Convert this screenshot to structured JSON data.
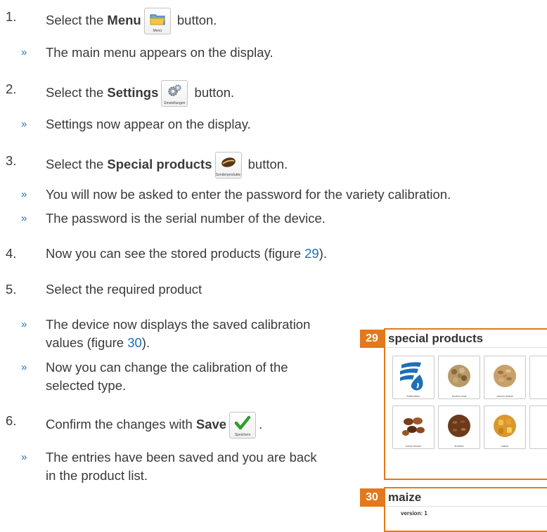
{
  "steps": [
    {
      "number": "1.",
      "prefix": "Select the ",
      "bold": "Menu",
      "suffix": " button.",
      "icon_name": "folder-icon",
      "icon_caption": "Menü"
    },
    {
      "number": "2.",
      "prefix": "Select the ",
      "bold": "Settings",
      "suffix": " button.",
      "icon_name": "gears-icon",
      "icon_caption": "Einstellungen"
    },
    {
      "number": "3.",
      "prefix": "Select the ",
      "bold": "Special products",
      "suffix": " button.",
      "icon_name": "bean-icon",
      "icon_caption": "Sonderprodukte"
    },
    {
      "number": "4.",
      "prefix": "Now you can see the stored products (figure ",
      "link": "29",
      "suffix": ")."
    },
    {
      "number": "5.",
      "text": "Select the required product"
    },
    {
      "number": "6.",
      "prefix": "Confirm the changes with ",
      "bold": "Save",
      "suffix": ".",
      "icon_name": "checkmark-icon",
      "icon_caption": "Speichern"
    }
  ],
  "results": {
    "r1": "The main menu appears on the display.",
    "r2": "Settings now appear on the display.",
    "r3a": "You will now be asked to enter the password for the variety calibration.",
    "r3b": "The password is the serial number of the device.",
    "r5a_l1": "The device now displays the saved calibration",
    "r5a_l2_pre": "values (figure ",
    "r5a_link": "30",
    "r5a_l2_suf": ").",
    "r5b_l1": "Now you can change the calibration of the",
    "r5b_l2": "selected type.",
    "r6_l1": "The entries have been saved and you are back",
    "r6_l2": "in the product list."
  },
  "bullet": "»",
  "figure29": {
    "number": "29",
    "title": "special products",
    "tiles": [
      {
        "caption": "Kalibration",
        "icon": "logo-icon"
      },
      {
        "caption": "buckw heat",
        "icon": "grain-icon"
      },
      {
        "caption": "durum wheat",
        "icon": "grain-icon"
      },
      {
        "caption": "horse beans",
        "icon": "bean-icon"
      },
      {
        "caption": "linseed",
        "icon": "grain-icon"
      },
      {
        "caption": "maize",
        "icon": "grain-icon"
      }
    ]
  },
  "figure30": {
    "number": "30",
    "title": "maize",
    "version": "version: 1"
  },
  "colors": {
    "accent": "#e3791a",
    "link": "#1e6fb5",
    "text": "#3a3a3a"
  }
}
